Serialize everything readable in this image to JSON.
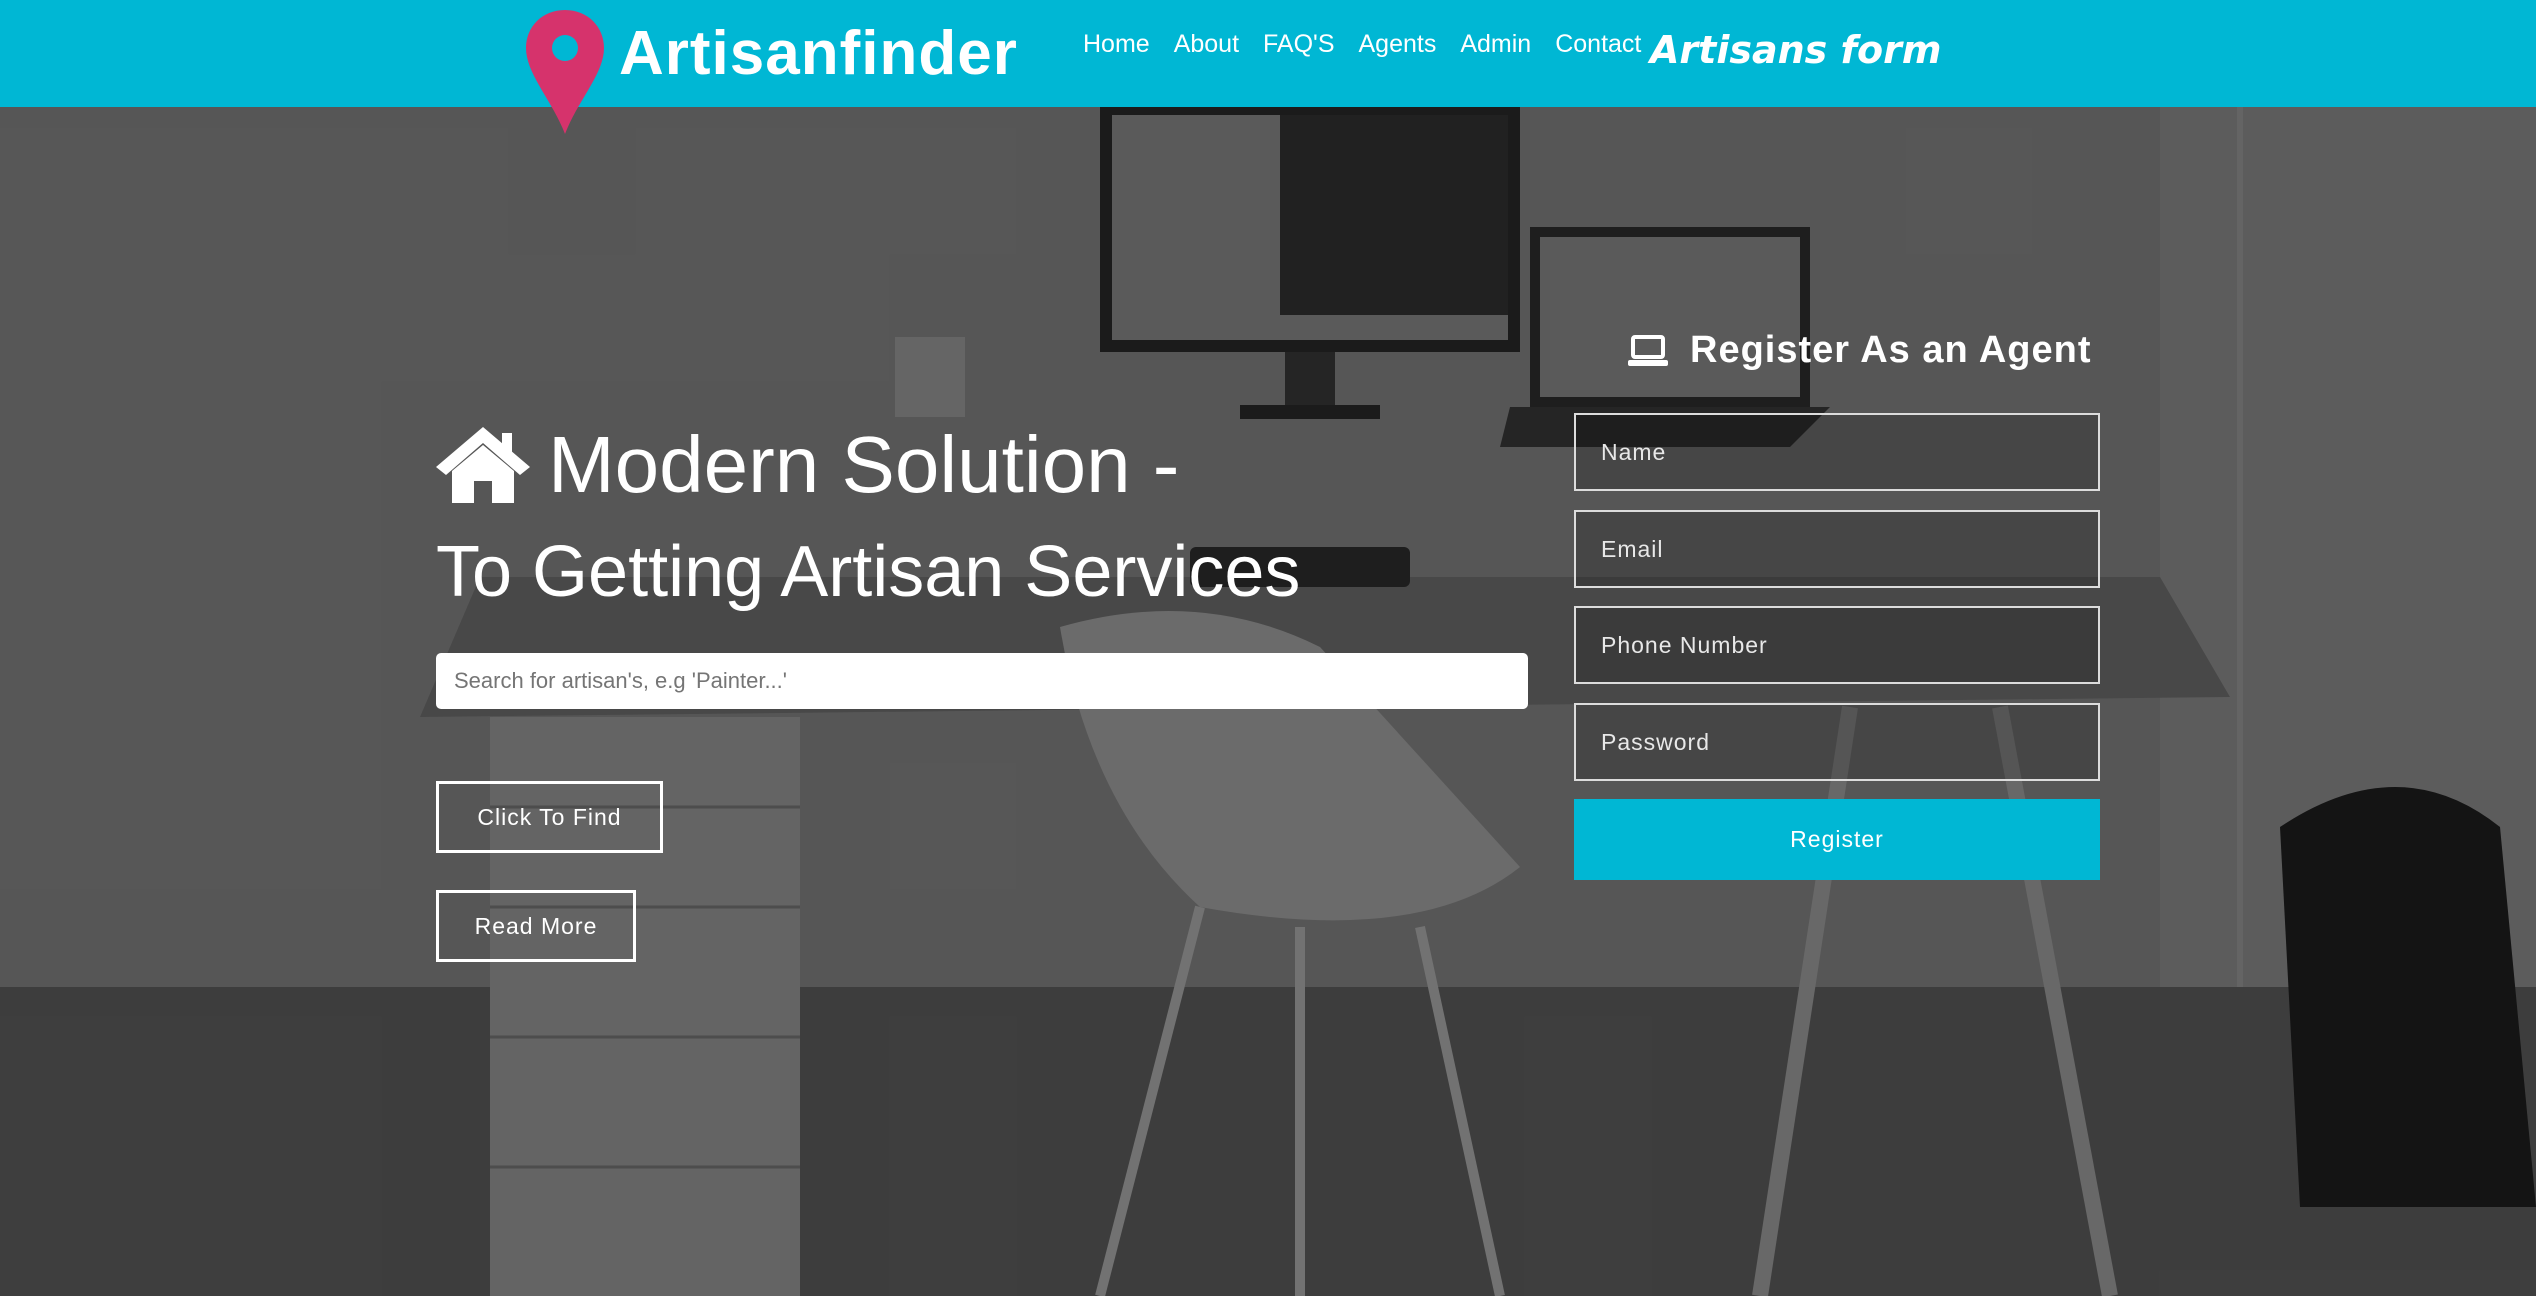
{
  "header": {
    "brand": "Artisanfinder",
    "nav": [
      "Home",
      "About",
      "FAQ'S",
      "Agents",
      "Admin",
      "Contact"
    ],
    "form_link": "Artisans form"
  },
  "hero": {
    "heading_line1": "Modern Solution -",
    "heading_line2": "To Getting Artisan Services",
    "search_placeholder": "Search for artisan's, e.g 'Painter...'",
    "find_button": "Click To Find",
    "read_more_button": "Read More"
  },
  "register": {
    "title": "Register As an Agent",
    "name_placeholder": "Name",
    "email_placeholder": "Email",
    "phone_placeholder": "Phone Number",
    "password_placeholder": "Password",
    "submit": "Register"
  },
  "colors": {
    "accent": "#00b7d4",
    "pin": "#d6336c"
  },
  "icons": [
    "location-pin-icon",
    "home-icon",
    "laptop-icon"
  ]
}
